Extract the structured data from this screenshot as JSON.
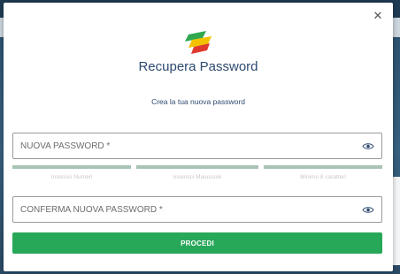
{
  "dialog": {
    "title": "Recupera Password",
    "subtitle": "Crea la tua nuova password",
    "close_icon": "close-icon"
  },
  "logo": {
    "icon": "brand-logo",
    "colors": [
      "#2fa84f",
      "#f2c200",
      "#e0392d"
    ]
  },
  "new_password": {
    "placeholder": "NUOVA PASSWORD *",
    "value": "",
    "toggle_icon": "eye-icon"
  },
  "strength": {
    "items": [
      {
        "label": "Inserisci Numeri"
      },
      {
        "label": "Inserisci Maiuscole"
      },
      {
        "label": "Minimo 8 caratteri"
      }
    ]
  },
  "confirm_password": {
    "placeholder": "CONFERMA NUOVA PASSWORD *",
    "value": "",
    "toggle_icon": "eye-icon"
  },
  "submit": {
    "label": "PROCEDI"
  },
  "colors": {
    "primary_text": "#2d4a70",
    "button": "#27a859",
    "strength_bar": "#a8c3b3"
  }
}
